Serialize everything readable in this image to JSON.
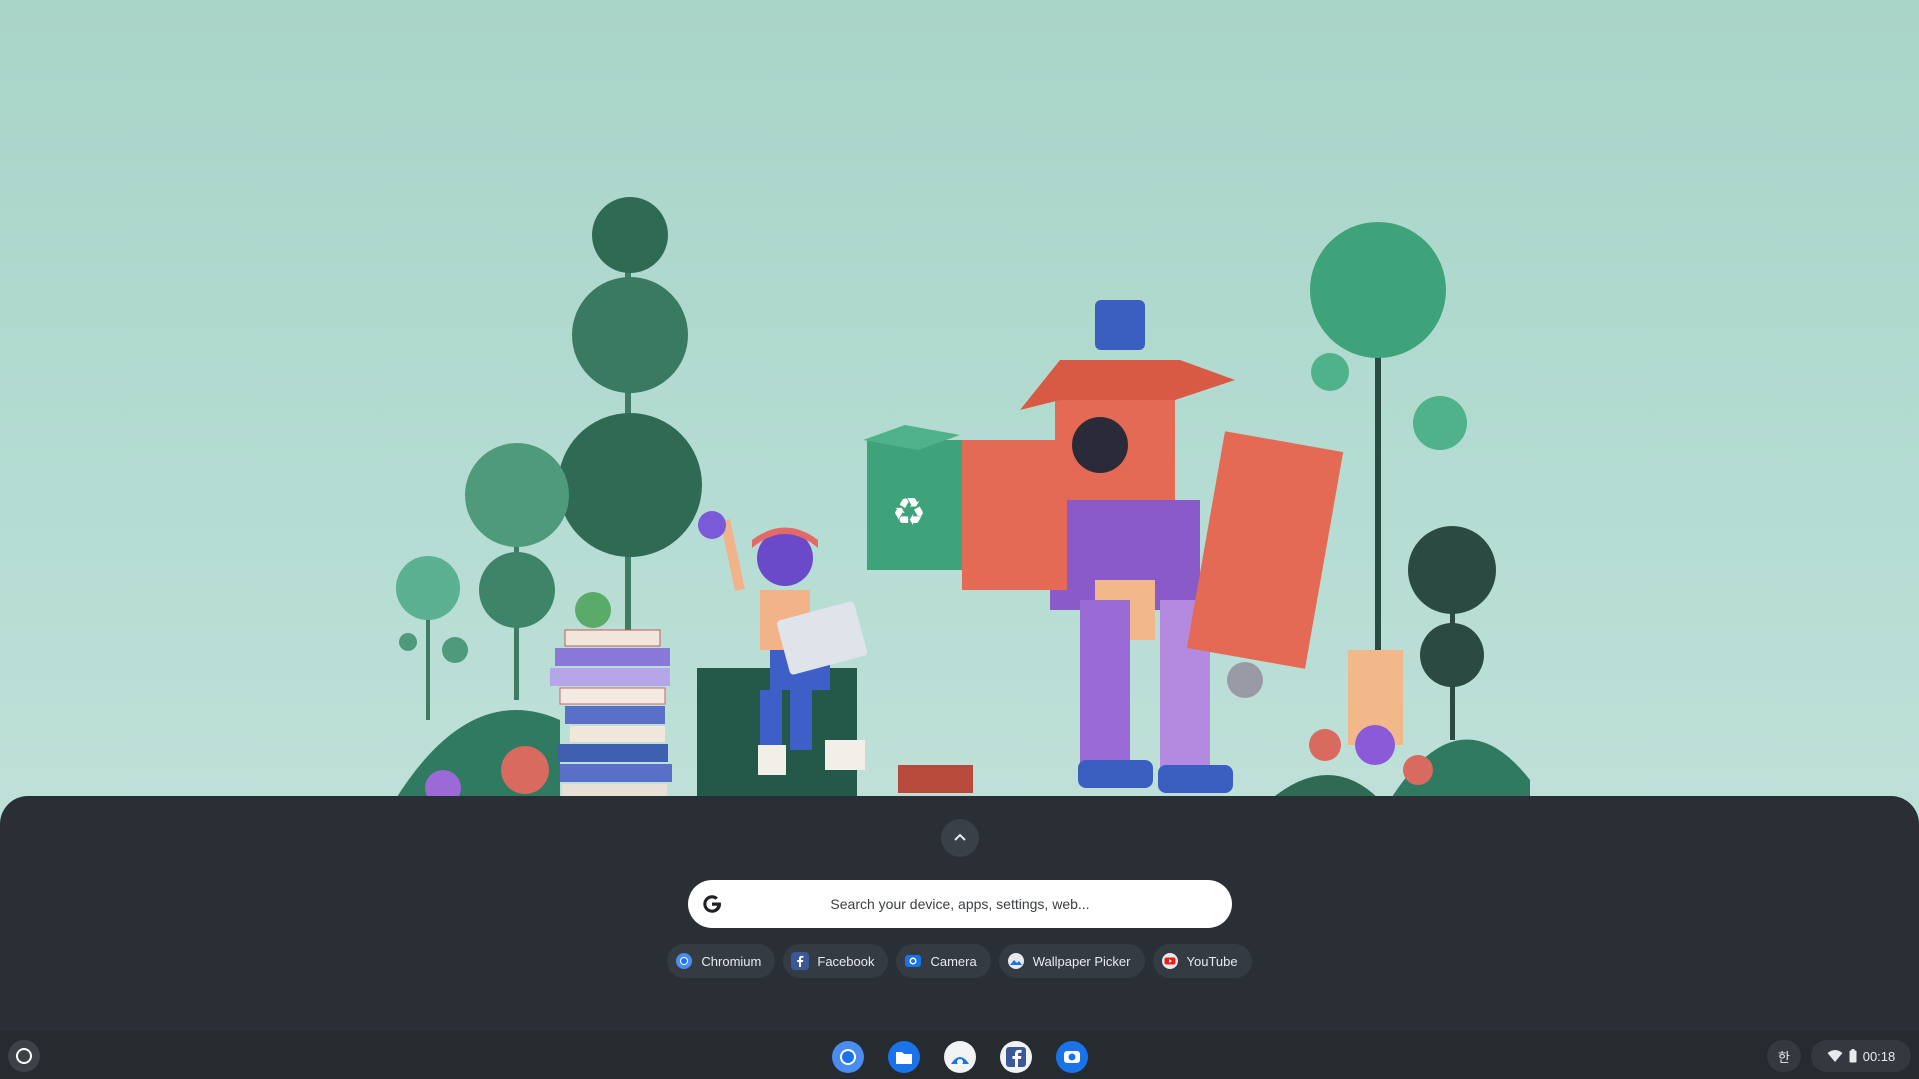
{
  "launcher": {
    "expand_icon": "chevron-up-icon",
    "search": {
      "placeholder": "Search your device, apps, settings, web...",
      "icon": "google-g-icon"
    },
    "suggestions": [
      {
        "label": "Chromium",
        "icon": "chromium-icon"
      },
      {
        "label": "Facebook",
        "icon": "facebook-icon"
      },
      {
        "label": "Camera",
        "icon": "camera-icon"
      },
      {
        "label": "Wallpaper Picker",
        "icon": "wallpaper-picker-icon"
      },
      {
        "label": "YouTube",
        "icon": "youtube-icon"
      }
    ]
  },
  "shelf": {
    "home_icon": "launcher-circle-icon",
    "pinned_apps": [
      "chromium",
      "files",
      "wallpaper-picker",
      "facebook",
      "camera"
    ],
    "ime_label": "한",
    "status": {
      "time": "00:18",
      "wifi_icon": "wifi-icon",
      "battery_icon": "battery-icon"
    }
  },
  "colors": {
    "launcher_bg": "#2a2f35",
    "chip_bg": "#353b42",
    "shelf_bg": "#262b30",
    "accent_blue": "#1a73e8"
  }
}
